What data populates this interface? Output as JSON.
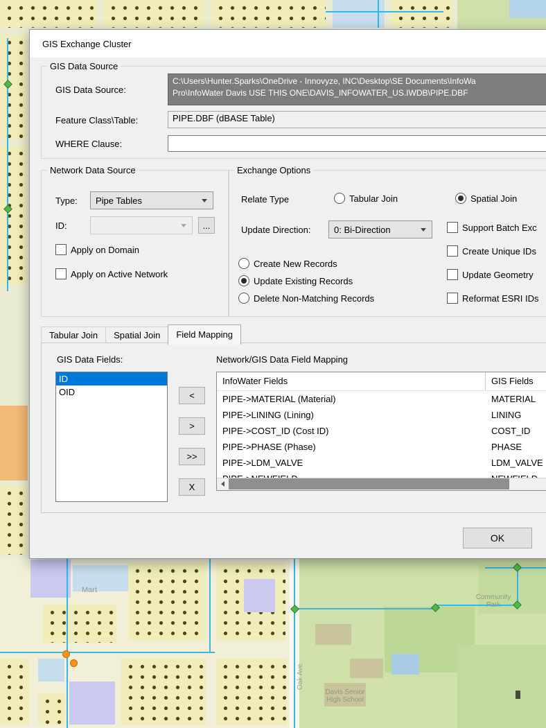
{
  "window": {
    "title": "GIS Exchange Cluster"
  },
  "gis_data_source": {
    "legend": "GIS Data Source",
    "path_label": "GIS Data Source:",
    "path_value": "C:\\Users\\Hunter.Sparks\\OneDrive - Innovyze, INC\\Desktop\\SE Documents\\InfoWa\nPro\\InfoWater Davis USE THIS ONE\\DAVIS_INFOWATER_US.IWDB\\PIPE.DBF",
    "feature_label": "Feature Class\\Table:",
    "feature_value": "PIPE.DBF (dBASE Table)",
    "where_label": "WHERE Clause:",
    "where_value": ""
  },
  "network_data_source": {
    "legend": "Network Data Source",
    "type_label": "Type:",
    "type_value": "Pipe Tables",
    "id_label": "ID:",
    "id_value": "",
    "browse_label": "...",
    "checkboxes": [
      {
        "label": "Apply on Domain",
        "checked": false
      },
      {
        "label": "Apply on Active Network",
        "checked": false
      }
    ]
  },
  "exchange_options": {
    "legend": "Exchange Options",
    "relate_type_label": "Relate Type",
    "relate_options": [
      {
        "label": "Tabular Join",
        "selected": false
      },
      {
        "label": "Spatial Join",
        "selected": true
      }
    ],
    "update_direction_label": "Update Direction:",
    "update_direction_value": "0: Bi-Direction",
    "record_options": [
      {
        "label": "Create New Records",
        "selected": false
      },
      {
        "label": "Update Existing Records",
        "selected": true
      },
      {
        "label": "Delete Non-Matching Records",
        "selected": false
      }
    ],
    "checkboxes": [
      {
        "label": "Support Batch Exc",
        "checked": false
      },
      {
        "label": "Create Unique IDs",
        "checked": false
      },
      {
        "label": "Update Geometry",
        "checked": false
      },
      {
        "label": "Reformat ESRI IDs",
        "checked": false
      }
    ]
  },
  "tabs": [
    {
      "label": "Tabular Join",
      "active": false
    },
    {
      "label": "Spatial Join",
      "active": false
    },
    {
      "label": "Field Mapping",
      "active": true
    }
  ],
  "field_mapping": {
    "gis_fields_label": "GIS Data Fields:",
    "gis_fields": [
      {
        "label": "ID",
        "selected": true
      },
      {
        "label": "OID",
        "selected": false
      }
    ],
    "transfer_buttons": [
      "<",
      ">",
      ">>",
      "X"
    ],
    "mapping_title": "Network/GIS Data Field Mapping",
    "columns": [
      "InfoWater Fields",
      "GIS Fields"
    ],
    "rows": [
      {
        "infowater": "PIPE->MATERIAL (Material)",
        "gis": "MATERIAL"
      },
      {
        "infowater": "PIPE->LINING (Lining)",
        "gis": "LINING"
      },
      {
        "infowater": "PIPE->COST_ID (Cost ID)",
        "gis": "COST_ID"
      },
      {
        "infowater": "PIPE->PHASE (Phase)",
        "gis": "PHASE"
      },
      {
        "infowater": "PIPE->LDM_VALVE",
        "gis": "LDM_VALVE"
      },
      {
        "infowater": "PIPE->NEWFIELD",
        "gis": "NEWFIELD"
      }
    ]
  },
  "ok_label": "OK",
  "map": {
    "labels": {
      "store": "Mart",
      "school": "Davis Senior\nHigh School",
      "park": "Community\nPark",
      "street": "Oak Ave"
    }
  },
  "colors": {
    "selection": "#0078d7",
    "pipe": "#35b6e6",
    "node": "#52b848",
    "junction": "#f7941d"
  }
}
